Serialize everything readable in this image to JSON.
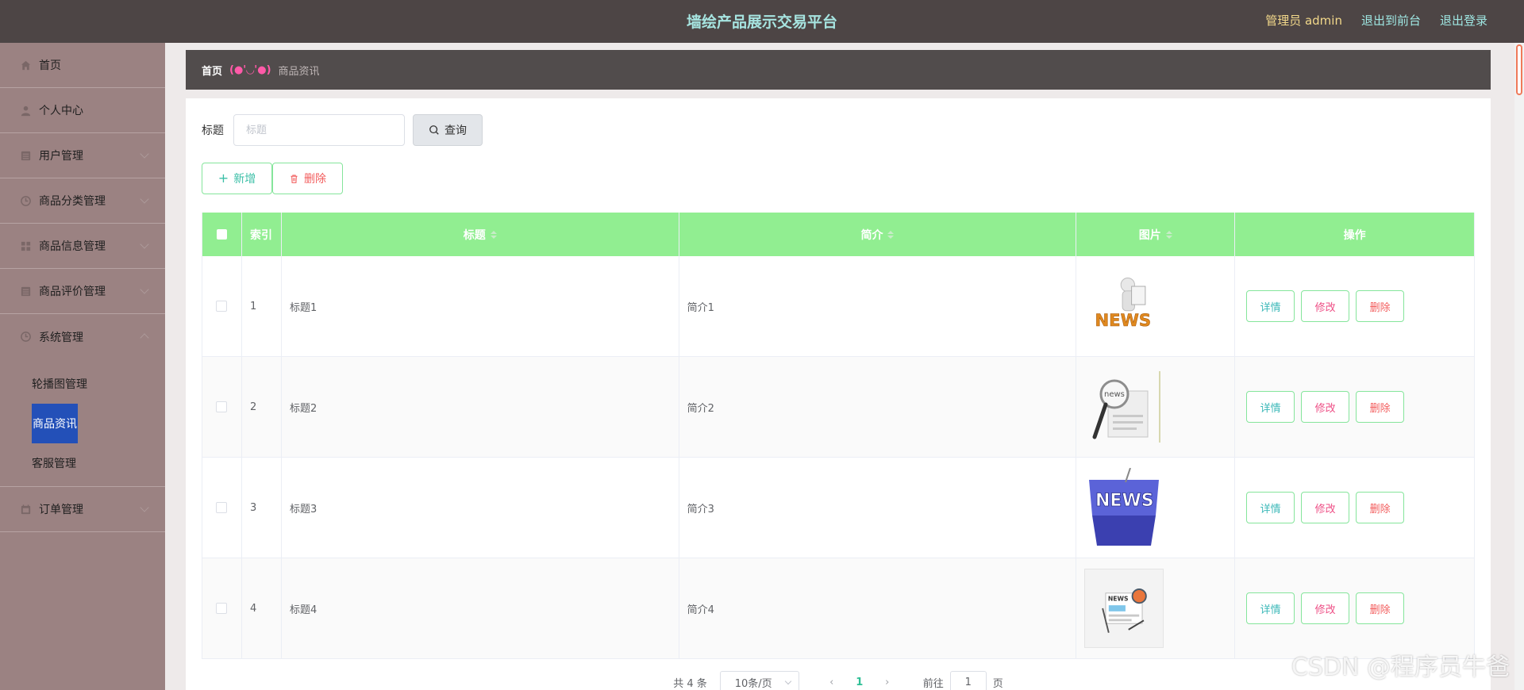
{
  "header": {
    "title": "墙绘产品展示交易平台",
    "admin": "管理员 admin",
    "to_front": "退出到前台",
    "logout": "退出登录"
  },
  "sidebar": {
    "items": [
      {
        "label": "首页",
        "icon": "home-icon"
      },
      {
        "label": "个人中心",
        "icon": "user-icon"
      },
      {
        "label": "用户管理",
        "icon": "list-icon"
      },
      {
        "label": "商品分类管理",
        "icon": "clock-icon"
      },
      {
        "label": "商品信息管理",
        "icon": "grid-icon"
      },
      {
        "label": "商品评价管理",
        "icon": "list-icon"
      },
      {
        "label": "系统管理",
        "icon": "clock-icon"
      },
      {
        "label": "订单管理",
        "icon": "calendar-icon"
      }
    ],
    "submenu": [
      {
        "label": "轮播图管理"
      },
      {
        "label": "商品资讯"
      },
      {
        "label": "客服管理"
      }
    ]
  },
  "breadcrumb": {
    "home": "首页",
    "separator": "(●'◡'●)",
    "current": "商品资讯"
  },
  "search": {
    "label": "标题",
    "placeholder": "标题",
    "value": "",
    "button": "查询"
  },
  "toolbar": {
    "add": "新增",
    "delete": "删除"
  },
  "table": {
    "columns": [
      "索引",
      "标题",
      "简介",
      "图片",
      "操作"
    ],
    "rows": [
      {
        "index": "1",
        "title": "标题1",
        "intro": "简介1",
        "image": "news-3d-figure"
      },
      {
        "index": "2",
        "title": "标题2",
        "intro": "简介2",
        "image": "news-magnifier"
      },
      {
        "index": "3",
        "title": "标题3",
        "intro": "简介3",
        "image": "news-keyboard-key"
      },
      {
        "index": "4",
        "title": "标题4",
        "intro": "简介4",
        "image": "news-flat-icon"
      }
    ],
    "actions": {
      "detail": "详情",
      "edit": "修改",
      "delete": "删除"
    }
  },
  "pagination": {
    "total": "共 4 条",
    "page_size": "10条/页",
    "current_page": "1",
    "goto_label": "前往",
    "goto_value": "1",
    "page_suffix": "页"
  },
  "watermark": "CSDN @程序员牛爸",
  "colors": {
    "header_bg": "#4d4545",
    "sidebar_bg": "#9b8282",
    "table_header": "#91ee91",
    "active_sub": "#2350b8",
    "title_text": "#a6e4e0"
  }
}
